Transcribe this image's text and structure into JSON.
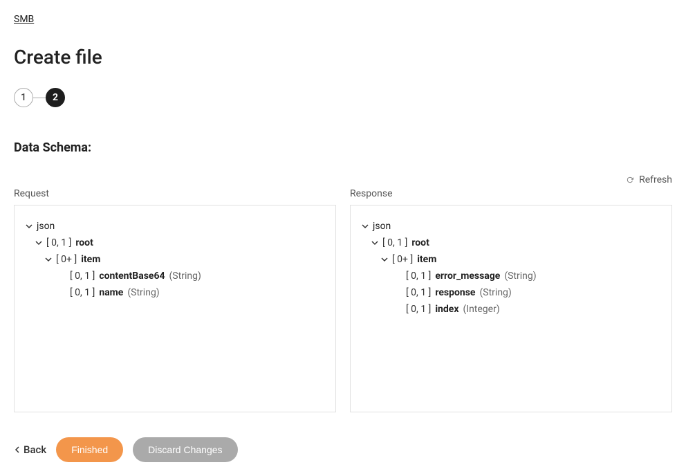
{
  "breadcrumb": {
    "label": "SMB"
  },
  "page_title": "Create file",
  "wizard": {
    "step1": "1",
    "step2": "2"
  },
  "section_title": "Data Schema:",
  "refresh_label": "Refresh",
  "panels": {
    "request": {
      "title": "Request",
      "tree": {
        "json_label": "json",
        "root_card": "[ 0, 1 ]",
        "root_name": "root",
        "item_card": "[ 0+ ]",
        "item_name": "item",
        "fields": [
          {
            "card": "[ 0, 1 ]",
            "name": "contentBase64",
            "type": "(String)"
          },
          {
            "card": "[ 0, 1 ]",
            "name": "name",
            "type": "(String)"
          }
        ]
      }
    },
    "response": {
      "title": "Response",
      "tree": {
        "json_label": "json",
        "root_card": "[ 0, 1 ]",
        "root_name": "root",
        "item_card": "[ 0+ ]",
        "item_name": "item",
        "fields": [
          {
            "card": "[ 0, 1 ]",
            "name": "error_message",
            "type": "(String)"
          },
          {
            "card": "[ 0, 1 ]",
            "name": "response",
            "type": "(String)"
          },
          {
            "card": "[ 0, 1 ]",
            "name": "index",
            "type": "(Integer)"
          }
        ]
      }
    }
  },
  "footer": {
    "back": "Back",
    "finished": "Finished",
    "discard": "Discard Changes"
  }
}
